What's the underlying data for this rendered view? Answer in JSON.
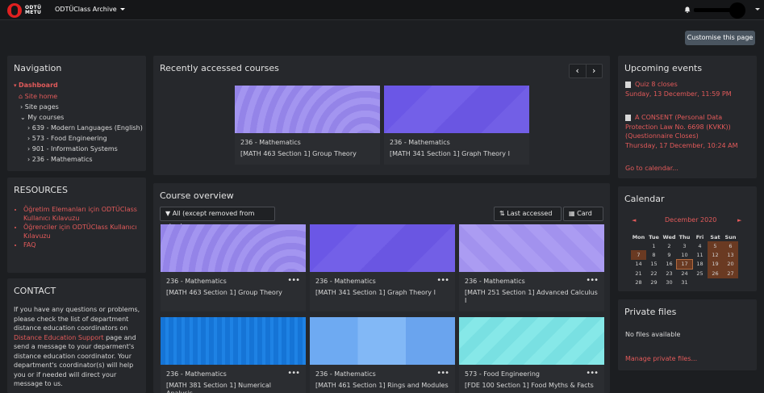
{
  "header": {
    "logo_text_1": "ODTÜ",
    "logo_text_2": "METU",
    "brand": "ODTÜClass Archive"
  },
  "customise_label": "Customise this page",
  "navigation": {
    "title": "Navigation",
    "items": [
      "Dashboard",
      "Site home",
      "Site pages",
      "My courses",
      "639 - Modern Languages (English)",
      "573 - Food Engineering",
      "901 - Information Systems",
      "236 - Mathematics"
    ]
  },
  "resources": {
    "title": "RESOURCES",
    "items": [
      "Öğretim Elemanları için ODTÜClass Kullanıcı Kılavuzu",
      "Öğrenciler için ODTÜClass Kullanıcı Kılavuzu",
      "FAQ"
    ]
  },
  "contact": {
    "title": "CONTACT",
    "text_1": "If you have any questions or problems, please check the list of department distance education coordinators on",
    "link": "Distance Education Support",
    "text_2": "page and send a message to your deparment's distance education coordinator. Your department's coordinator(s) will help you or if needed will direct your message to us."
  },
  "recent": {
    "title": "Recently accessed courses",
    "courses": [
      {
        "cat": "236 - Mathematics",
        "name": "[MATH 463 Section 1] Group Theory"
      },
      {
        "cat": "236 - Mathematics",
        "name": "[MATH 341 Section 1] Graph Theory I"
      }
    ]
  },
  "overview": {
    "title": "Course overview",
    "filter": "All (except removed from view)",
    "sort": "Last accessed",
    "view": "Card",
    "courses": [
      {
        "cat": "236 - Mathematics",
        "name": "[MATH 463 Section 1] Group Theory"
      },
      {
        "cat": "236 - Mathematics",
        "name": "[MATH 341 Section 1] Graph Theory I"
      },
      {
        "cat": "236 - Mathematics",
        "name": "[MATH 251 Section 1] Advanced Calculus I"
      },
      {
        "cat": "236 - Mathematics",
        "name": "[MATH 381 Section 1] Numerical Analysis"
      },
      {
        "cat": "236 - Mathematics",
        "name": "[MATH 461 Section 1] Rings and Modules"
      },
      {
        "cat": "573 - Food Engineering",
        "name": "[FDE 100 Section 1] Food Myths & Facts"
      }
    ],
    "menu_dots": "•••"
  },
  "events": {
    "title": "Upcoming events",
    "items": [
      {
        "name": "Quiz 8 closes",
        "date": "Sunday, 13 December, 11:59 PM"
      },
      {
        "name": "A CONSENT (Personal Data Protection Law No. 6698 (KVKK)) (Questionnaire Closes)",
        "date": "Thursday, 17 December, 10:24 AM"
      }
    ],
    "goto": "Go to calendar..."
  },
  "calendar": {
    "title": "Calendar",
    "month": "December 2020",
    "prev": "◄",
    "next": "►",
    "days": [
      "Mon",
      "Tue",
      "Wed",
      "Thu",
      "Fri",
      "Sat",
      "Sun"
    ],
    "weeks": [
      [
        "",
        "1",
        "2",
        "3",
        "4",
        "5",
        "6"
      ],
      [
        "7",
        "8",
        "9",
        "10",
        "11",
        "12",
        "13"
      ],
      [
        "14",
        "15",
        "16",
        "17",
        "18",
        "19",
        "20"
      ],
      [
        "21",
        "22",
        "23",
        "24",
        "25",
        "26",
        "27"
      ],
      [
        "28",
        "29",
        "30",
        "31",
        "",
        "",
        ""
      ]
    ]
  },
  "private": {
    "title": "Private files",
    "empty": "No files available",
    "manage": "Manage private files..."
  }
}
